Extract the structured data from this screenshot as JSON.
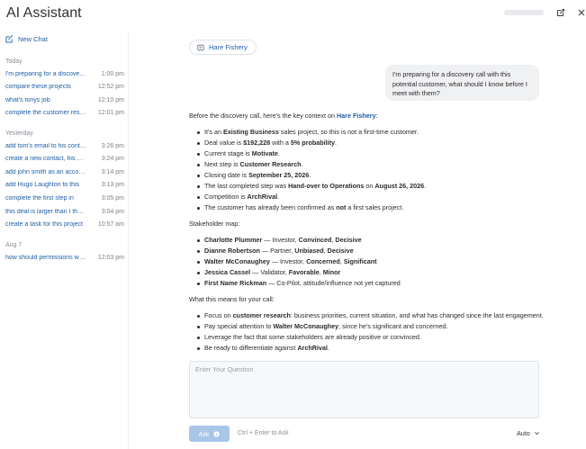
{
  "app": {
    "title": "AI Assistant"
  },
  "header": {
    "pill_icon": "loading-pill",
    "expand_icon": "edit-open-icon",
    "close_icon": "close-icon"
  },
  "sidebar": {
    "new_chat_label": "New Chat",
    "groups": [
      {
        "label": "Today",
        "items": [
          {
            "title": "I'm preparing for a discovery call with Hare Fishery",
            "time": "1:00 pm"
          },
          {
            "title": "compare these projects",
            "time": "12:52 pm"
          },
          {
            "title": "what's tonys job",
            "time": "12:10 pm"
          },
          {
            "title": "complete the customer research",
            "time": "12:01 pm"
          }
        ]
      },
      {
        "label": "Yesterday",
        "items": [
          {
            "title": "add tom's email to his contact",
            "time": "3:26 pm"
          },
          {
            "title": "create a new contact, his name",
            "time": "3:24 pm"
          },
          {
            "title": "add john smith as an account",
            "time": "3:14 pm"
          },
          {
            "title": "add Hugo Laughton to this",
            "time": "3:13 pm"
          },
          {
            "title": "complete the first step in",
            "time": "3:05 pm"
          },
          {
            "title": "this deal is larger than I thought",
            "time": "3:04 pm"
          },
          {
            "title": "create a task for this project",
            "time": "10:57 am"
          }
        ]
      },
      {
        "label": "Aug 7",
        "items": [
          {
            "title": "how should permissions work",
            "time": "12:03 pm"
          }
        ]
      }
    ]
  },
  "main": {
    "context_chip": "Hare Fishery",
    "user_message": "I'm preparing for a discovery call with this potential customer, what should I know before I meet with them?",
    "answer": {
      "intro_pre": "Before the discovery call, here's the key context on ",
      "intro_link": "Hare Fishery",
      "intro_post": ":",
      "facts": {
        "f1_pre": "It's an ",
        "f1_bold": "Existing Business",
        "f1_post": " sales project, so this is not a first-time customer.",
        "f2_pre": "Deal value is ",
        "f2_bold1": "$192,228",
        "f2_mid": " with a ",
        "f2_bold2": "5% probability",
        "f2_post": ".",
        "f3_pre": "Current stage is ",
        "f3_bold": "Motivate",
        "f3_post": ".",
        "f4_pre": "Next step is ",
        "f4_bold": "Customer Research",
        "f4_post": ".",
        "f5_pre": "Closing date is ",
        "f5_bold": "September 25, 2026",
        "f5_post": ".",
        "f6_pre": "The last completed step was ",
        "f6_bold1": "Hand-over to Operations",
        "f6_mid": " on ",
        "f6_bold2": "August 26, 2026",
        "f6_post": ".",
        "f7_pre": "Competition is ",
        "f7_bold": "ArchRival",
        "f7_post": ".",
        "f8_pre": "The customer has already been confirmed as ",
        "f8_bold": "not",
        "f8_post": " a first sales project."
      },
      "stakeholder_heading": "Stakeholder map:",
      "stakeholders": [
        {
          "name": "Charlotte Plummer",
          "role": " — Investor, ",
          "a1": "Convinced",
          "sep": ", ",
          "a2": "Decisive",
          "tail": ""
        },
        {
          "name": "Dianne Robertson",
          "role": " — Partner, ",
          "a1": "Unbiased",
          "sep": ", ",
          "a2": "Decisive",
          "tail": ""
        },
        {
          "name": "Walter McConaughey",
          "role": " — Investor, ",
          "a1": "Concerned",
          "sep": ", ",
          "a2": "Significant",
          "tail": ""
        },
        {
          "name": "Jessica Cassel",
          "role": " — Validator, ",
          "a1": "Favorable",
          "sep": ", ",
          "a2": "Minor",
          "tail": ""
        },
        {
          "name": "First Name Rickman",
          "role": " — Co-Pilot, attitude/influence not yet captured",
          "a1": "",
          "sep": "",
          "a2": "",
          "tail": ""
        }
      ],
      "meaning_heading": "What this means for your call:",
      "advice": {
        "a1_pre": "Focus on ",
        "a1_bold": "customer research",
        "a1_post": ": business priorities, current situation, and what has changed since the last engagement.",
        "a2_pre": "Pay special attention to ",
        "a2_bold": "Walter McConaughey",
        "a2_post": ", since he's significant and concerned.",
        "a3": "Leverage the fact that some stakeholders are already positive or convinced.",
        "a4_pre": "Be ready to differentiate against ",
        "a4_bold": "ArchRival",
        "a4_post": "."
      }
    },
    "input": {
      "placeholder": "Enter Your Question",
      "value": ""
    },
    "ask_label": "Ask",
    "shortcut_hint": "Ctrl + Enter to Ask",
    "mode_label": "Auto"
  },
  "colors": {
    "accent": "#1f5fa6",
    "ask_button": "#a9c6e9",
    "bubble": "#f0f1f3"
  }
}
